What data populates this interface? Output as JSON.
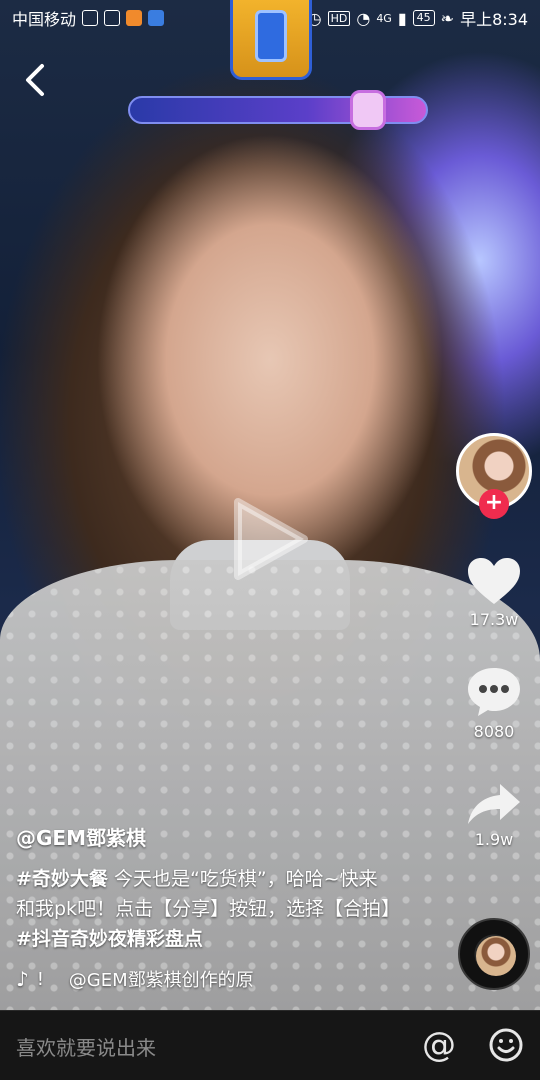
{
  "status_bar": {
    "carrier": "中国移动",
    "network": "4G",
    "battery": "45",
    "time": "早上8:34"
  },
  "actions": {
    "like_count": "17.3w",
    "comment_count": "8080",
    "share_count": "1.9w"
  },
  "caption": {
    "author": "@GEM鄧紫棋",
    "hashtag_1": "#奇妙大餐",
    "text_1": " 今天也是“吃货棋”，哈哈~快来和我pk吧！点击【分享】按钮，选择【合拍】",
    "hashtag_2": "#抖音奇妙夜精彩盘点"
  },
  "music": {
    "title": "@GEM鄧紫棋创作的原"
  },
  "comment_bar": {
    "placeholder": "喜欢就要说出来",
    "at_symbol": "@"
  },
  "icons": {
    "back": "back-chevron-icon",
    "play": "play-icon",
    "like": "heart-icon",
    "comment": "comment-bubble-icon",
    "share": "share-arrow-icon",
    "music": "tiktok-note-icon",
    "emoji": "emoji-smile-icon"
  }
}
